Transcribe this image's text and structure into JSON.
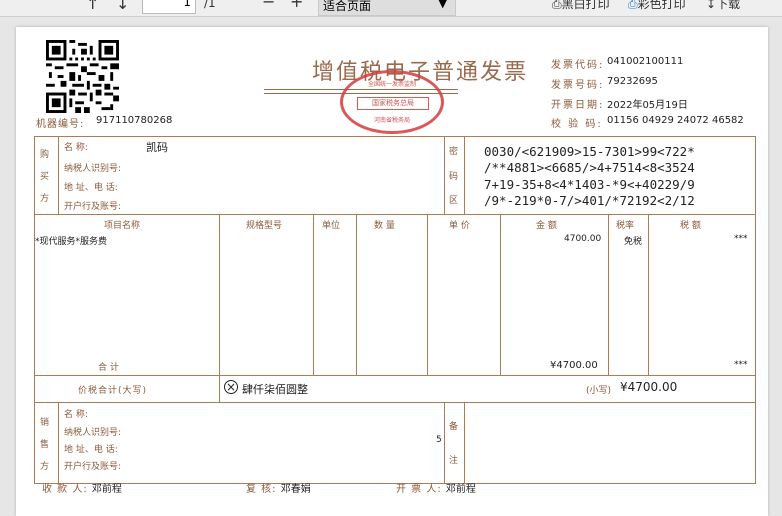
{
  "toolbar": {
    "page_value": "1",
    "page_total": "/1",
    "zoom_select": "适合页面",
    "print_bw": "黑白打印",
    "print_color": "彩色打印",
    "download": "下载"
  },
  "invoice": {
    "title": "增值税电子普通发票",
    "seal": {
      "arc": "全国统一发票监制",
      "band": "国家税务总局",
      "bottom": "河南省税务局"
    },
    "machine_no_label": "机器编号:",
    "machine_no": "917110780268",
    "code_label": "发票代码:",
    "code": "041002100111",
    "number_label": "发票号码:",
    "number": "79232695",
    "date_label": "开票日期:",
    "date": "2022年05月19日",
    "check_label": "校 验 码:",
    "check": "01156 04929 24072 46582",
    "buyer": {
      "section": [
        "购",
        "买",
        "方"
      ],
      "name_label": "名      称:",
      "name": "凯码",
      "taxid_label": "纳税人识别号:",
      "addr_label": "地 址、电 话:",
      "bank_label": "开户行及账号:"
    },
    "cipher_label": [
      "密",
      "码",
      "区"
    ],
    "cipher_lines": [
      "0030/<621909>15-7301>99<722*",
      "/**4881><6685/>4+7514<8<3524",
      "7+19-35+8<4*1403-*9<+40229/9",
      "/9*-219*0-7/>401/*72192<2/12"
    ],
    "headers": {
      "item": "项目名称",
      "spec": "规格型号",
      "unit": "单位",
      "qty": "数  量",
      "price": "单  价",
      "amount": "金  额",
      "rate": "税率",
      "tax": "税  额"
    },
    "item_row": {
      "item": "*现代服务*服务费",
      "amount": "4700.00",
      "rate": "免税",
      "tax": "***"
    },
    "total_label": "合        计",
    "total_amount": "¥4700.00",
    "total_tax": "***",
    "grand_label": "价税合计(大写)",
    "grand_upper": "肆仟柒佰圆整",
    "grand_small_label": "(小写)",
    "grand_small": "¥4700.00",
    "seller": {
      "section": [
        "销",
        "售",
        "方"
      ],
      "name_label": "名      称:",
      "taxid_label": "纳税人识别号:",
      "addr_label": "地 址、电 话:",
      "bank_label": "开户行及账号:",
      "addr_digit": "5"
    },
    "remark_label": [
      "备",
      "注"
    ],
    "payee_label": "收 款 人:",
    "payee": "邓前程",
    "reviewer_label": "复  核:",
    "reviewer": "邓春娟",
    "drawer_label": "开 票 人:",
    "drawer": "邓前程"
  }
}
